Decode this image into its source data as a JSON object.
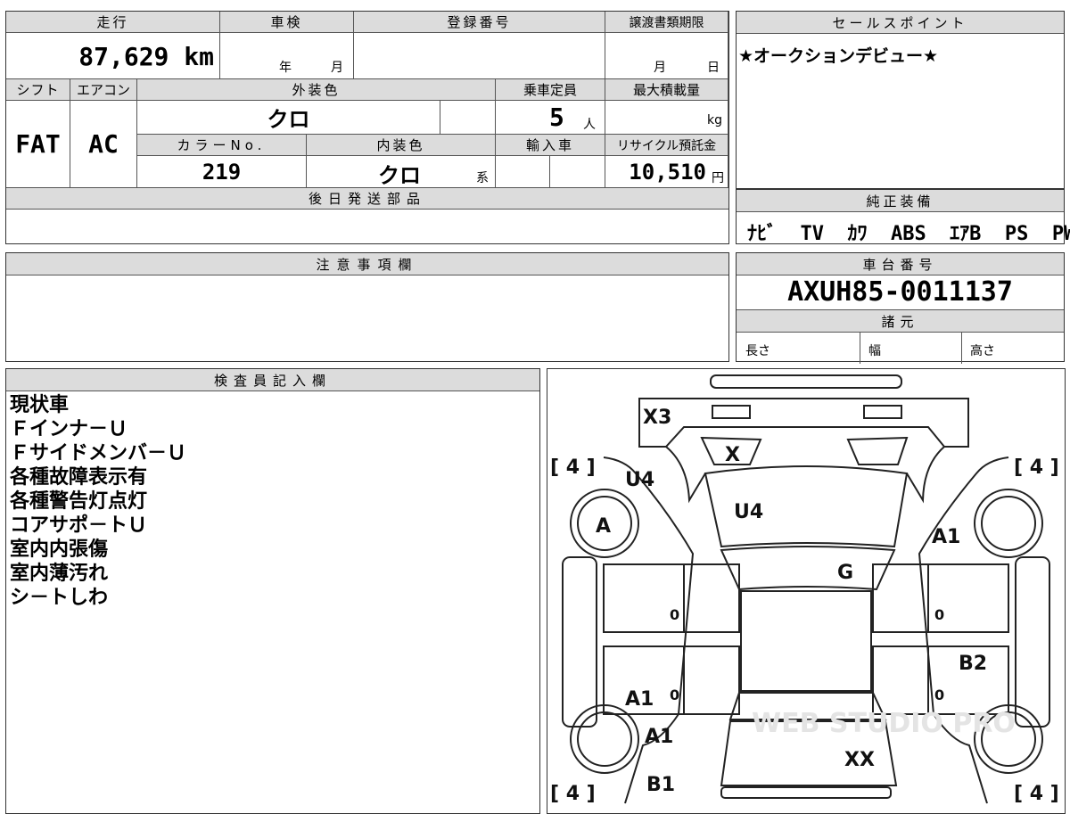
{
  "mileage": {
    "label": "走行",
    "value": "87,629",
    "unit": "km"
  },
  "shaken": {
    "label": "車検",
    "year_label": "年",
    "month_label": "月"
  },
  "registration": {
    "label": "登録番号"
  },
  "transfer_deadline": {
    "label": "譲渡書類期限",
    "month_label": "月",
    "day_label": "日"
  },
  "shift": {
    "label": "シフト",
    "value": "FAT"
  },
  "aircon": {
    "label": "エアコン",
    "value": "AC"
  },
  "exterior_color": {
    "label": "外装色",
    "value": "クロ"
  },
  "capacity": {
    "label": "乗車定員",
    "value": "5",
    "unit": "人"
  },
  "max_load": {
    "label": "最大積載量",
    "unit": "kg"
  },
  "color_no": {
    "label": "カラーNo.",
    "value": "219"
  },
  "interior_color": {
    "label": "内装色",
    "value": "クロ",
    "suffix": "系"
  },
  "import": {
    "label": "輸入車"
  },
  "recycle": {
    "label": "リサイクル預託金",
    "value": "10,510",
    "unit": "円"
  },
  "later_parts": {
    "label": "後日発送部品"
  },
  "sales_point": {
    "label": "セールスポイント",
    "text": "★オークションデビュー★"
  },
  "equipment": {
    "label": "純正装備",
    "items": "ﾅﾋﾞ  TV  ｶﾜ  ABS  ｴｱB  PS  PW"
  },
  "caution": {
    "label": "注意事項欄"
  },
  "chassis": {
    "label": "車台番号",
    "value": "AXUH85-0011137"
  },
  "specs": {
    "label": "諸元",
    "length": "長さ",
    "width": "幅",
    "height": "高さ"
  },
  "inspector": {
    "label": "検査員記入欄",
    "lines": [
      "現状車",
      "Ｆインナ－Ｕ",
      "Ｆサイドメンバ－Ｕ",
      "各種故障表示有",
      "各種警告灯点灯",
      "コアサポ－トＵ",
      "室内内張傷",
      "室内薄汚れ",
      "シ－トしわ"
    ]
  },
  "diagram": {
    "tire_marks": [
      "[ 4 ]",
      "[ 4 ]",
      "[ 4 ]",
      "[ 4 ]"
    ],
    "marks": {
      "x3": "X3",
      "x": "X",
      "u4_left": "U4",
      "u4_hood": "U4",
      "a_wheel": "A",
      "a1_right": "A1",
      "g": "G",
      "b2": "B2",
      "a1_left_door": "A1",
      "a1_left_low": "A1",
      "b1": "B1",
      "xx": "XX"
    },
    "zeros": [
      "0",
      "0",
      "0",
      "0"
    ],
    "watermark": "WEB STUDIO PRO"
  }
}
